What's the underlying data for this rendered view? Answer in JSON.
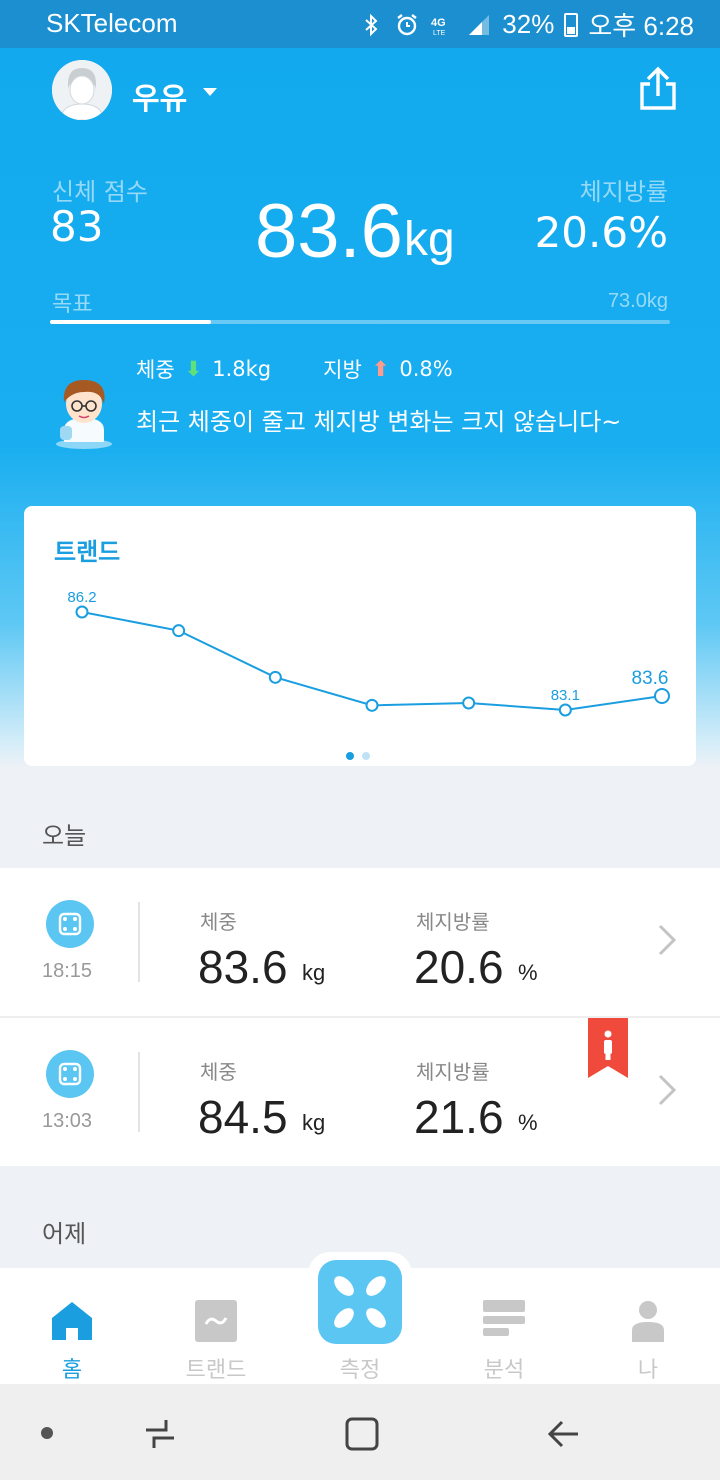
{
  "status_bar": {
    "carrier": "SKTelecom",
    "battery": "32%",
    "time": "오후 6:28",
    "icons": [
      "bluetooth-icon",
      "alarm-icon",
      "4g-lte-icon",
      "signal-icon",
      "battery-icon"
    ]
  },
  "header": {
    "user_name": "우유",
    "body_score_label": "신체 점수",
    "body_score": "83",
    "weight_value": "83.6",
    "weight_unit": "kg",
    "fat_label": "체지방률",
    "fat_value": "20.6%",
    "goal_label": "목표",
    "goal_value": "73.0kg",
    "goal_progress": 0.26
  },
  "summary": {
    "weight_label": "체중",
    "weight_change": "1.8kg",
    "fat_label": "지방",
    "fat_change": "0.8%",
    "message": "최근 체중이 줄고 체지방 변화는 크지 않습니다~"
  },
  "trend": {
    "title": "트랜드",
    "page_count": 2,
    "active_page": 0
  },
  "chart_data": {
    "type": "line",
    "title": "트랜드",
    "x": [
      1,
      2,
      3,
      4,
      5,
      6,
      7
    ],
    "series": [
      {
        "values": [
          86.2,
          85.8,
          84.8,
          84.2,
          84.25,
          84.1,
          84.4
        ]
      }
    ],
    "data_labels": [
      {
        "index": 0,
        "text": "86.2"
      },
      {
        "index": 5,
        "text": "83.1"
      },
      {
        "index": 6,
        "text": "83.6"
      }
    ],
    "ylim": [
      83.8,
      86.5
    ],
    "grid": false,
    "color": "#1a9ee0"
  },
  "today": {
    "label": "오늘",
    "records": [
      {
        "time": "18:15",
        "weight_label": "체중",
        "weight": "83.6",
        "weight_unit": "kg",
        "fat_label": "체지방률",
        "fat": "20.6",
        "fat_unit": "%"
      },
      {
        "time": "13:03",
        "weight_label": "체중",
        "weight": "84.5",
        "weight_unit": "kg",
        "fat_label": "체지방률",
        "fat": "21.6",
        "fat_unit": "%"
      }
    ]
  },
  "yesterday": {
    "label": "어제"
  },
  "bottom_nav": {
    "items": [
      {
        "label": "홈",
        "icon": "home-icon"
      },
      {
        "label": "트랜드",
        "icon": "trend-icon"
      },
      {
        "label": "측정",
        "icon": "scale-icon"
      },
      {
        "label": "분석",
        "icon": "analysis-icon"
      },
      {
        "label": "나",
        "icon": "person-icon"
      }
    ],
    "active": 0
  },
  "colors": {
    "accent": "#1a9ee0",
    "header": "#12a9ee",
    "down": "#5fe07a",
    "up": "#ff9b8a",
    "bookmark": "#f04a3c"
  }
}
